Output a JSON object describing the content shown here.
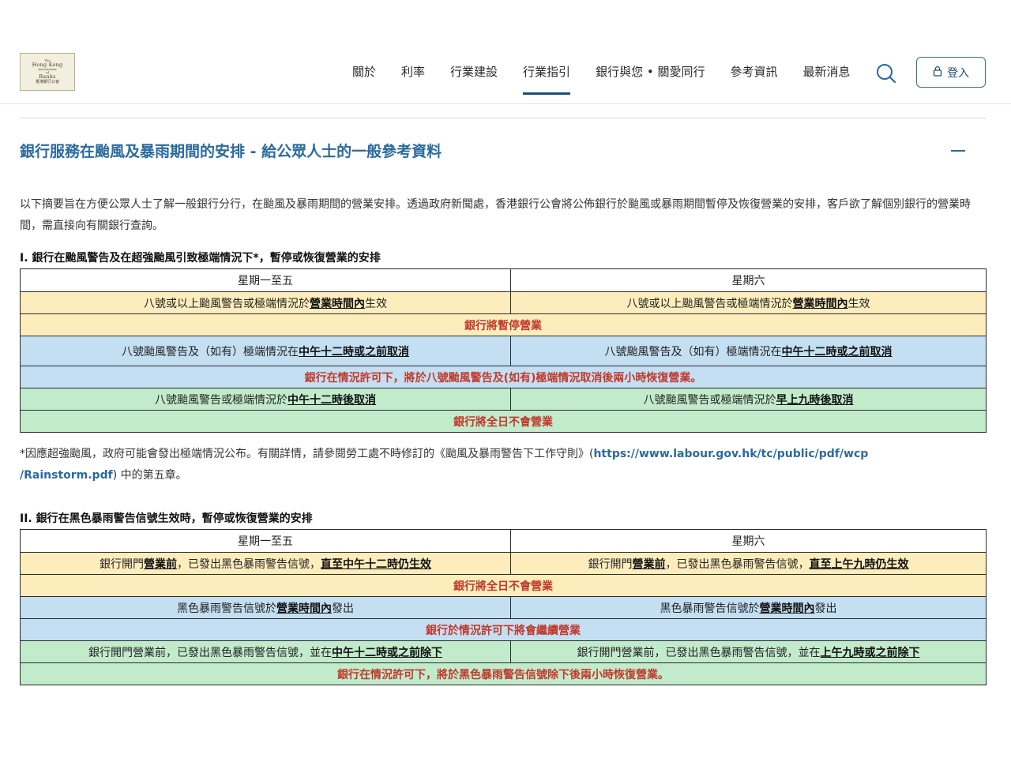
{
  "logo": {
    "line1": "The",
    "line2": "Hong Kong",
    "line3": "Association",
    "line4": "of",
    "line5": "Banks",
    "line6": "香港銀行公會"
  },
  "nav": {
    "items": [
      {
        "label": "關於"
      },
      {
        "label": "利率"
      },
      {
        "label": "行業建設"
      },
      {
        "label": "行業指引",
        "active": true
      },
      {
        "label": "銀行與您 • 關愛同行"
      },
      {
        "label": "參考資訊"
      },
      {
        "label": "最新消息"
      }
    ],
    "search_icon": "search-icon",
    "login_label": "登入",
    "login_icon": "lock-icon"
  },
  "section": {
    "title": "銀行服務在颱風及暴雨期間的安排 - 給公眾人士的一般參考資料",
    "intro": "以下摘要旨在方便公眾人士了解一般銀行分行，在颱風及暴雨期間的營業安排。透過政府新聞處，香港銀行公會將公佈銀行於颱風或暴雨期間暫停及恢復營業的安排，客戶欲了解個別銀行的營業時間，需直接向有關銀行查詢。"
  },
  "typhoon": {
    "heading": "I. 銀行在颱風警告及在超強颱風引致極端情況下*，暫停或恢復營業的安排",
    "col_weekday": "星期一至五",
    "col_saturday": "星期六",
    "r1_weekday_pre": "八號或以上颱風警告或極端情況於",
    "r1_weekday_em": "營業時間內",
    "r1_weekday_post": "生效",
    "r1_sat_pre": "八號或以上颱風警告或極端情況於",
    "r1_sat_em": "營業時間內",
    "r1_sat_post": "生效",
    "r2": "銀行將暫停營業",
    "r3_weekday_pre": "八號颱風警告及（如有）極端情況在",
    "r3_weekday_em": "中午十二時或之前取消",
    "r3_sat_pre": "八號颱風警告及（如有）極端情況在",
    "r3_sat_em": "中午十二時或之前取消",
    "r4": "銀行在情況許可下，將於八號颱風警告及(如有)極端情況取消後兩小時恢復營業。",
    "r5_weekday_pre": "八號颱風警告或極端情況於",
    "r5_weekday_em": "中午十二時後取消",
    "r5_sat_pre": "八號颱風警告或極端情況於",
    "r5_sat_em": "早上九時後取消",
    "r6": "銀行將全日不會營業"
  },
  "footnote": {
    "text_pre": "*因應超強颱風，政府可能會發出極端情況公布。有關詳情，請參閱勞工處不時修訂的《颱風及暴雨警告下工作守則》(",
    "link_part1": "https://www.labour.gov.hk/tc/public/pdf/wcp",
    "link_part2": "/Rainstorm.pdf",
    "text_post": ") 中的第五章。"
  },
  "rainstorm": {
    "heading": "II. 銀行在黑色暴雨警告信號生效時，暫停或恢復營業的安排",
    "col_weekday": "星期一至五",
    "col_saturday": "星期六",
    "r1_weekday_pre": "銀行開門",
    "r1_weekday_em1": "營業前",
    "r1_weekday_mid": "，已發出黑色暴雨警告信號，",
    "r1_weekday_em2": "直至中午十二時仍生效",
    "r1_sat_pre": "銀行開門",
    "r1_sat_em1": "營業前",
    "r1_sat_mid": "，已發出黑色暴雨警告信號，",
    "r1_sat_em2": "直至上午九時仍生效",
    "r2": "銀行將全日不會營業",
    "r3_weekday_pre": "黑色暴雨警告信號於",
    "r3_weekday_em": "營業時間內",
    "r3_weekday_post": "發出",
    "r3_sat_pre": "黑色暴雨警告信號於",
    "r3_sat_em": "營業時間內",
    "r3_sat_post": "發出",
    "r4": "銀行於情況許可下將會繼續營業",
    "r5_weekday_pre": "銀行開門營業前，已發出黑色暴雨警告信號，並在",
    "r5_weekday_em": "中午十二時或之前除下",
    "r5_sat_pre": "銀行開門營業前，已發出黑色暴雨警告信號，並在",
    "r5_sat_em": "上午九時或之前除下",
    "r6": "銀行在情況許可下，將於黑色暴雨警告信號除下後兩小時恢復營業。"
  }
}
